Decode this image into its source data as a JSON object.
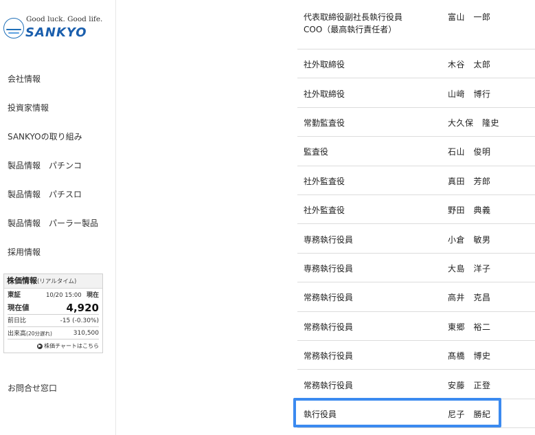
{
  "logo": {
    "tagline": "Good luck. Good life.",
    "brand": "SANKYO"
  },
  "nav": {
    "items": [
      "会社情報",
      "投資家情報",
      "SANKYOの取り組み",
      "製品情報　パチンコ",
      "製品情報　パチスロ",
      "製品情報　パーラー製品",
      "採用情報"
    ],
    "contact": "お問合せ窓口"
  },
  "stock": {
    "title": "株価情報",
    "subtitle": "(リアルタイム)",
    "exchange": "東証",
    "datetime": "10/20 15:00",
    "current_label": "現在",
    "price_label": "現在値",
    "price": "4,920",
    "change_label": "前日比",
    "change": "-15 (-0.30%)",
    "volume_label": "出来高",
    "volume_note": "(20分遅れ)",
    "volume": "310,500",
    "chart_link": "株価チャートはこちら"
  },
  "officers": [
    {
      "role": [
        "代表取締役副社長執行役員",
        "COO（最高執行責任者）"
      ],
      "name": "富山　一郎"
    },
    {
      "role": [
        "社外取締役"
      ],
      "name": "木谷　太郎"
    },
    {
      "role": [
        "社外取締役"
      ],
      "name": "山﨑　博行"
    },
    {
      "role": [
        "常勤監査役"
      ],
      "name": "大久保　隆史"
    },
    {
      "role": [
        "監査役"
      ],
      "name": "石山　俊明"
    },
    {
      "role": [
        "社外監査役"
      ],
      "name": "真田　芳郎"
    },
    {
      "role": [
        "社外監査役"
      ],
      "name": "野田　典義"
    },
    {
      "role": [
        "専務執行役員"
      ],
      "name": "小倉　敏男"
    },
    {
      "role": [
        "専務執行役員"
      ],
      "name": "大島　洋子"
    },
    {
      "role": [
        "常務執行役員"
      ],
      "name": "高井　克昌"
    },
    {
      "role": [
        "常務執行役員"
      ],
      "name": "東郷　裕二"
    },
    {
      "role": [
        "常務執行役員"
      ],
      "name": "髙橋　博史"
    },
    {
      "role": [
        "常務執行役員"
      ],
      "name": "安藤　正登"
    },
    {
      "role": [
        "執行役員"
      ],
      "name": "尼子　勝紀"
    }
  ],
  "colors": {
    "brand": "#1b5fad",
    "highlight": "#3b8af0"
  }
}
